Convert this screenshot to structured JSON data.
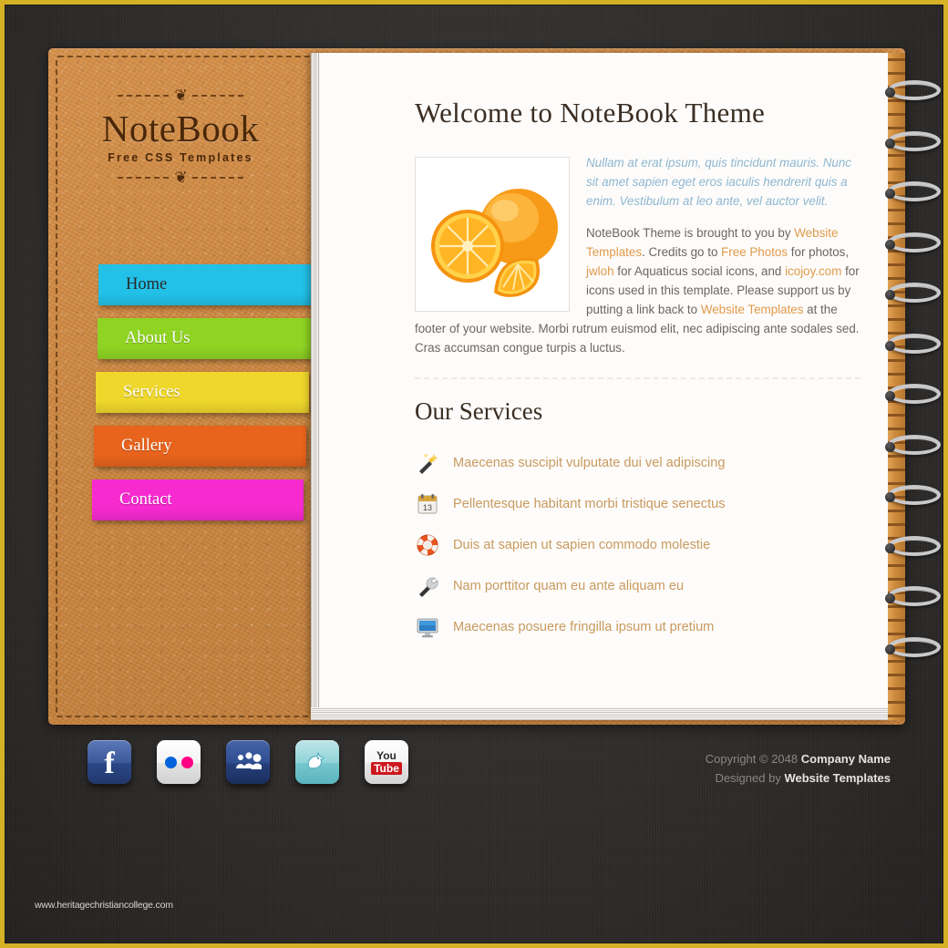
{
  "brand": {
    "title": "NoteBook",
    "subtitle": "Free CSS Templates",
    "ornament_glyph": "❦"
  },
  "nav": {
    "items": [
      {
        "label": "Home",
        "color": "#22c1e8",
        "active": true
      },
      {
        "label": "About Us",
        "color": "#8fd423",
        "active": false
      },
      {
        "label": "Services",
        "color": "#efd72c",
        "active": false
      },
      {
        "label": "Gallery",
        "color": "#e8631c",
        "active": false
      },
      {
        "label": "Contact",
        "color": "#f72ad0",
        "active": false
      }
    ]
  },
  "main": {
    "page_title": "Welcome to NoteBook Theme",
    "photo_alt": "oranges-photo",
    "lead": "Nullam at erat ipsum, quis tincidunt mauris. Nunc sit amet sapien eget eros iaculis hendrerit quis a enim. Vestibulum at leo ante, vel auctor velit.",
    "body": {
      "t1": "NoteBook Theme is brought to you by ",
      "l1": "Website Templates",
      "t2": ". Credits go to ",
      "l2": "Free Photos",
      "t3": " for photos, ",
      "l3": "jwloh",
      "t4": " for Aquaticus social icons, and ",
      "l4": "icojoy.com",
      "t5": " for icons used in this template. Please support us by putting a link back to ",
      "l5": "Website Templates",
      "t6": " at the footer of your website. Morbi rutrum euismod elit, nec adipiscing ante sodales sed. Cras accumsan congue turpis a luctus."
    },
    "services_title": "Our Services",
    "services": [
      {
        "icon": "magic-wand-icon",
        "label": "Maecenas suscipit vulputate dui vel adipiscing"
      },
      {
        "icon": "calendar-icon",
        "label": "Pellentesque habitant morbi tristique senectus",
        "calendar_day": "13"
      },
      {
        "icon": "life-ring-icon",
        "label": "Duis at sapien ut sapien commodo molestie"
      },
      {
        "icon": "wrench-icon",
        "label": "Nam porttitor quam eu ante aliquam eu"
      },
      {
        "icon": "monitor-icon",
        "label": "Maecenas posuere fringilla ipsum ut pretium"
      }
    ]
  },
  "footer": {
    "social": [
      {
        "name": "facebook-icon",
        "label": "f"
      },
      {
        "name": "flickr-icon",
        "label": ""
      },
      {
        "name": "myspace-icon",
        "label": ""
      },
      {
        "name": "twitter-icon",
        "label": "t"
      },
      {
        "name": "youtube-icon",
        "label": "You Tube",
        "you": "You",
        "tube": "Tube"
      }
    ],
    "copyright_prefix": "Copyright © 2048 ",
    "company": "Company Name",
    "designed_prefix": "Designed by ",
    "designer": "Website Templates"
  },
  "watermark": "www.heritagechristiancollege.com",
  "colors": {
    "gold_frame": "#d4b125",
    "leather": "#cd8740",
    "paper": "#fdfcfb",
    "link": "#e09a4a",
    "lead_text": "#8fb7cf",
    "service_text": "#c99a5e",
    "heading": "#3b2e23"
  }
}
